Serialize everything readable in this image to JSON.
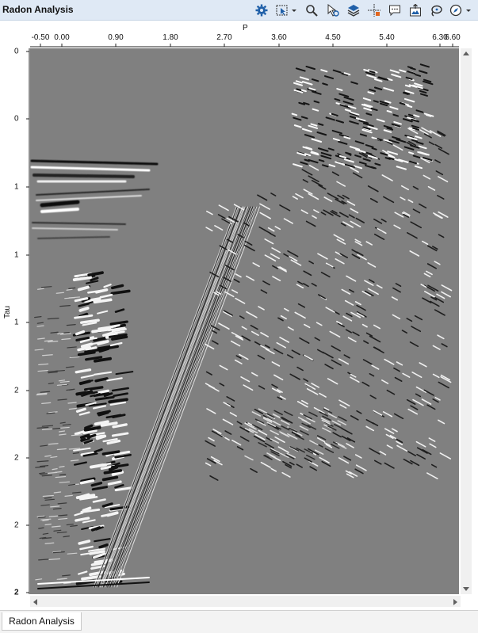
{
  "window": {
    "title": "Radon Analysis"
  },
  "toolbar": {
    "icons": [
      "gear-icon",
      "select-box-icon",
      "magnifier-icon",
      "mouse-pointer-icon",
      "layers-icon",
      "crosshair-icon",
      "comment-icon",
      "export-image-icon",
      "lasso-icon",
      "compass-icon"
    ]
  },
  "plot": {
    "x_axis_title": "P",
    "y_axis_title": "Tau",
    "x_ticks": [
      "-0.50",
      "0.00",
      "0.90",
      "1.80",
      "2.70",
      "3.60",
      "4.50",
      "5.40",
      "6.30",
      "6.60"
    ],
    "y_ticks": [
      "0",
      "0",
      "1",
      "1",
      "1",
      "2",
      "2",
      "2",
      "2"
    ]
  },
  "tabs": [
    {
      "label": "Radon Analysis"
    }
  ],
  "colors": {
    "background_gray": "#808080",
    "titlebar": "#dfe9f5",
    "icon_blue": "#1f5fa8"
  }
}
